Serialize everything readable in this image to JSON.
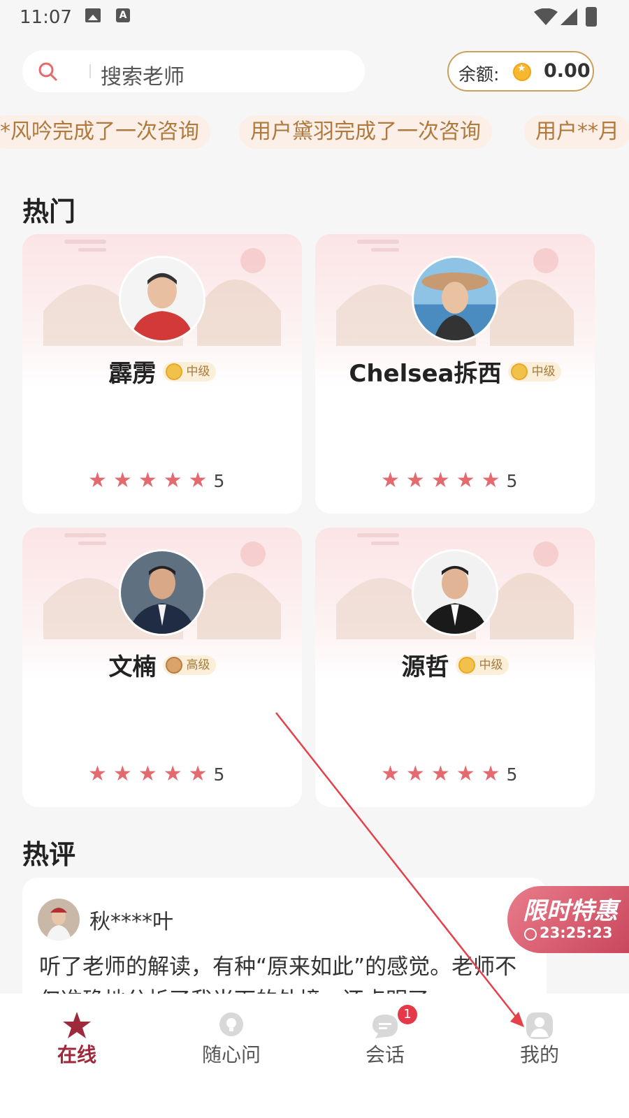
{
  "status_bar": {
    "time": "11:07",
    "icon_a": "A"
  },
  "search": {
    "placeholder": "搜索老师"
  },
  "balance": {
    "label": "余额:",
    "value": "0.00"
  },
  "ticker": {
    "items": [
      "*风吟完成了一次咨询",
      "用户黛羽完成了一次咨询",
      "用户**月"
    ]
  },
  "hot": {
    "title": "热门",
    "teachers": [
      {
        "name": "霹雳",
        "level": "中级",
        "rating": "5"
      },
      {
        "name": "Chelsea拆西",
        "level": "中级",
        "rating": "5"
      },
      {
        "name": "文楠",
        "level": "高级",
        "rating": "5"
      },
      {
        "name": "源哲",
        "level": "中级",
        "rating": "5"
      }
    ]
  },
  "reviews": {
    "title": "热评",
    "items": [
      {
        "reviewer": "秋****叶",
        "text": "听了老师的解读，有种“原来如此”的感觉。老师不仅准确地分析了我当下的处境，还点明了"
      }
    ]
  },
  "promo": {
    "title": "限时特惠",
    "countdown": "23:25:23"
  },
  "nav": {
    "items": [
      {
        "label": "在线",
        "icon": "star-icon",
        "active": true
      },
      {
        "label": "随心问",
        "icon": "lightbulb-icon",
        "active": false
      },
      {
        "label": "会话",
        "icon": "chat-icon",
        "active": false,
        "badge": "1"
      },
      {
        "label": "我的",
        "icon": "profile-icon",
        "active": false
      }
    ]
  },
  "colors": {
    "accent": "#9c2a3a",
    "star": "#e36a6e",
    "ticker_text": "#b07a3e",
    "gold": "#c9a15a"
  }
}
